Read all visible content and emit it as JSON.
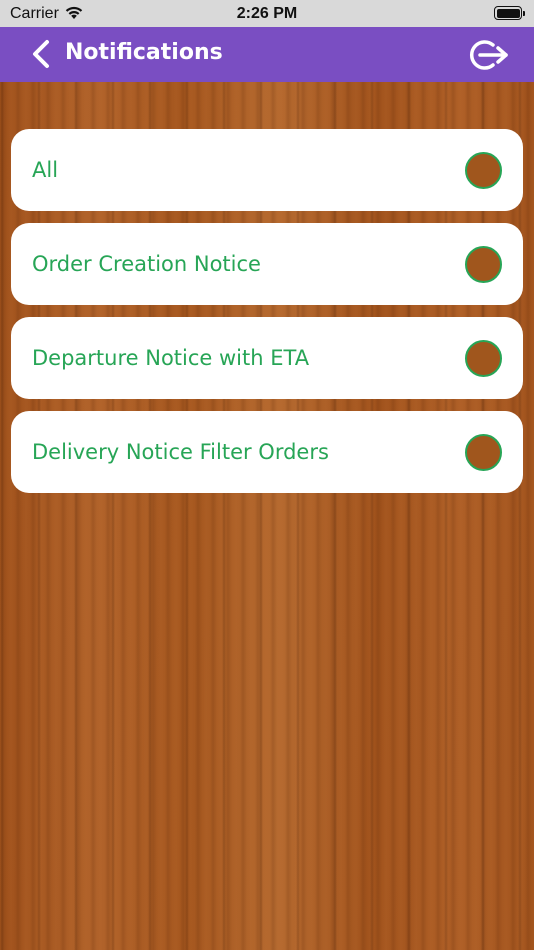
{
  "status_bar": {
    "carrier": "Carrier",
    "time": "2:26 PM"
  },
  "nav": {
    "title": "Notifications"
  },
  "items": [
    {
      "label": "All"
    },
    {
      "label": "Order Creation Notice"
    },
    {
      "label": "Departure Notice with ETA"
    },
    {
      "label": "Delivery Notice Filter Orders"
    }
  ],
  "colors": {
    "nav_bar": "#7a4ec2",
    "label_text": "#27a556",
    "radio_fill": "#a0561d",
    "radio_border": "#27a556",
    "card": "#ffffff"
  }
}
